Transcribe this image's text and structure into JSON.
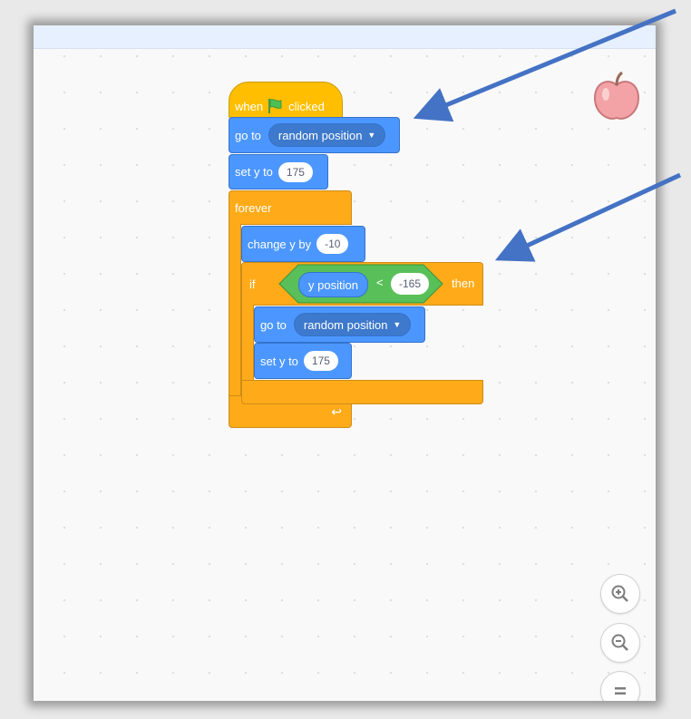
{
  "blocks": {
    "when_clicked": {
      "label_when": "when",
      "label_clicked": "clicked"
    },
    "go_to_1": {
      "label": "go to",
      "value": "random position"
    },
    "set_y_1": {
      "label": "set y to",
      "value": "175"
    },
    "forever": {
      "label": "forever"
    },
    "change_y": {
      "label": "change y by",
      "value": "-10"
    },
    "if_block": {
      "label": "if",
      "then": "then"
    },
    "condition": {
      "reporter": "y position",
      "operator": "<",
      "value": "-165"
    },
    "go_to_2": {
      "label": "go to",
      "value": "random position"
    },
    "set_y_2": {
      "label": "set y to",
      "value": "175"
    }
  },
  "sprite": {
    "icon": "apple-icon"
  },
  "zoom": {
    "in_icon": "zoom-in-icon",
    "out_icon": "zoom-out-icon",
    "reset_icon": "zoom-reset-icon"
  },
  "colors": {
    "motion": "#4c97ff",
    "control": "#ffab19",
    "event": "#ffbf00",
    "operator": "#59c059",
    "arrow": "#4472c4"
  }
}
